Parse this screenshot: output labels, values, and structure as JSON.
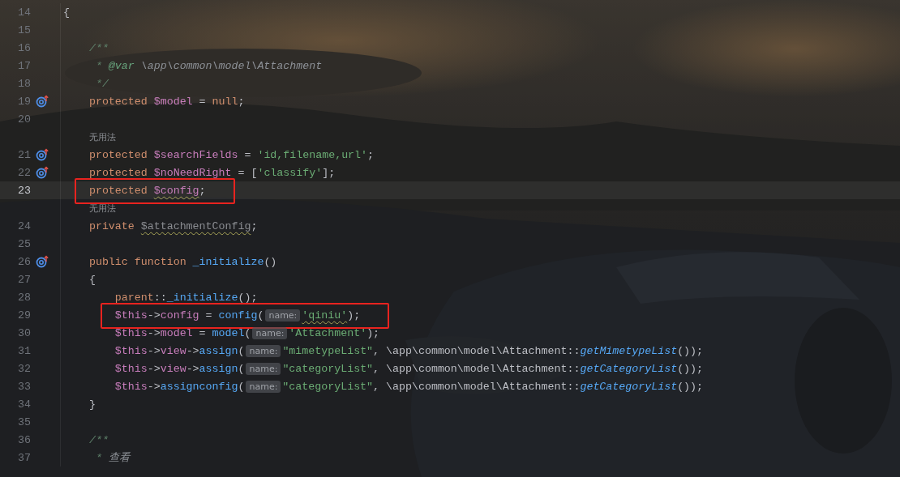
{
  "editor": {
    "lines": [
      {
        "kind": "code",
        "number": "14",
        "overrides": false,
        "current": false,
        "boxed": false,
        "tokens": [
          {
            "t": "{",
            "kind": "plain"
          }
        ]
      },
      {
        "kind": "code",
        "number": "15",
        "overrides": false,
        "current": false,
        "boxed": false
      },
      {
        "kind": "code",
        "number": "16",
        "overrides": false,
        "current": false,
        "boxed": false,
        "tokens": [
          {
            "t": "    /**",
            "kind": "doc"
          }
        ]
      },
      {
        "kind": "code",
        "number": "17",
        "overrides": false,
        "current": false,
        "boxed": false,
        "tokens": [
          {
            "t": "     * ",
            "kind": "doc"
          },
          {
            "t": "@var",
            "kind": "doctag"
          },
          {
            "t": " \\app\\common\\model\\Attachment",
            "kind": "doctext"
          }
        ]
      },
      {
        "kind": "code",
        "number": "18",
        "overrides": false,
        "current": false,
        "boxed": false,
        "tokens": [
          {
            "t": "     */",
            "kind": "doc"
          }
        ]
      },
      {
        "kind": "code",
        "number": "19",
        "overrides": true,
        "current": false,
        "boxed": false,
        "tokens": [
          {
            "t": "    protected ",
            "kind": "kw"
          },
          {
            "t": "$model",
            "kind": "var"
          },
          {
            "t": " = ",
            "kind": "plain"
          },
          {
            "t": "null",
            "kind": "kw"
          },
          {
            "t": ";",
            "kind": "plain"
          }
        ]
      },
      {
        "kind": "code",
        "number": "20",
        "overrides": false,
        "current": false,
        "boxed": false
      },
      {
        "kind": "hint",
        "text": "无用法"
      },
      {
        "kind": "code",
        "number": "21",
        "overrides": true,
        "current": false,
        "boxed": false,
        "tokens": [
          {
            "t": "    protected ",
            "kind": "kw"
          },
          {
            "t": "$searchFields",
            "kind": "var"
          },
          {
            "t": " = ",
            "kind": "plain"
          },
          {
            "t": "'id,filename,url'",
            "kind": "str"
          },
          {
            "t": ";",
            "kind": "plain"
          }
        ]
      },
      {
        "kind": "code",
        "number": "22",
        "overrides": true,
        "current": false,
        "boxed": false,
        "tokens": [
          {
            "t": "    protected ",
            "kind": "kw"
          },
          {
            "t": "$noNeedRight",
            "kind": "var"
          },
          {
            "t": " = [",
            "kind": "plain"
          },
          {
            "t": "'classify'",
            "kind": "str"
          },
          {
            "t": "];",
            "kind": "plain"
          }
        ]
      },
      {
        "kind": "code",
        "number": "23",
        "overrides": false,
        "current": true,
        "boxed": true,
        "tokens": [
          {
            "t": "    protected ",
            "kind": "kw"
          },
          {
            "t": "$config",
            "kind": "var_warn"
          },
          {
            "t": ";",
            "kind": "plain"
          }
        ]
      },
      {
        "kind": "hint",
        "text": "无用法"
      },
      {
        "kind": "code",
        "number": "24",
        "overrides": false,
        "current": false,
        "boxed": false,
        "tokens": [
          {
            "t": "    private ",
            "kind": "kw"
          },
          {
            "t": "$attachmentConfig",
            "kind": "unused"
          },
          {
            "t": ";",
            "kind": "plain"
          }
        ]
      },
      {
        "kind": "code",
        "number": "25",
        "overrides": false,
        "current": false,
        "boxed": false
      },
      {
        "kind": "code",
        "number": "26",
        "overrides": true,
        "current": false,
        "boxed": false,
        "tokens": [
          {
            "t": "    public function ",
            "kind": "kw"
          },
          {
            "t": "_initialize",
            "kind": "fn"
          },
          {
            "t": "()",
            "kind": "plain"
          }
        ]
      },
      {
        "kind": "code",
        "number": "27",
        "overrides": false,
        "current": false,
        "boxed": false,
        "tokens": [
          {
            "t": "    {",
            "kind": "plain"
          }
        ]
      },
      {
        "kind": "code",
        "number": "28",
        "overrides": false,
        "current": false,
        "boxed": false,
        "tokens": [
          {
            "t": "        parent",
            "kind": "kw"
          },
          {
            "t": "::",
            "kind": "plain"
          },
          {
            "t": "_initialize",
            "kind": "fn"
          },
          {
            "t": "();",
            "kind": "plain"
          }
        ]
      },
      {
        "kind": "code",
        "number": "29",
        "overrides": false,
        "current": false,
        "boxed": true,
        "tokens": [
          {
            "t": "        $this",
            "kind": "var"
          },
          {
            "t": "->",
            "kind": "plain"
          },
          {
            "t": "config",
            "kind": "var"
          },
          {
            "t": " = ",
            "kind": "plain"
          },
          {
            "t": "config",
            "kind": "fn"
          },
          {
            "t": "(",
            "kind": "plain"
          },
          {
            "t": "name:",
            "kind": "param"
          },
          {
            "t": "'qiniu'",
            "kind": "str_warn"
          },
          {
            "t": ");",
            "kind": "plain"
          }
        ]
      },
      {
        "kind": "code",
        "number": "30",
        "overrides": false,
        "current": false,
        "boxed": false,
        "tokens": [
          {
            "t": "        $this",
            "kind": "var"
          },
          {
            "t": "->",
            "kind": "plain"
          },
          {
            "t": "model",
            "kind": "var"
          },
          {
            "t": " = ",
            "kind": "plain"
          },
          {
            "t": "model",
            "kind": "fn"
          },
          {
            "t": "(",
            "kind": "plain"
          },
          {
            "t": "name:",
            "kind": "param"
          },
          {
            "t": "'Attachment'",
            "kind": "str"
          },
          {
            "t": ");",
            "kind": "plain"
          }
        ]
      },
      {
        "kind": "code",
        "number": "31",
        "overrides": false,
        "current": false,
        "boxed": false,
        "tokens": [
          {
            "t": "        $this",
            "kind": "var"
          },
          {
            "t": "->",
            "kind": "plain"
          },
          {
            "t": "view",
            "kind": "var"
          },
          {
            "t": "->",
            "kind": "plain"
          },
          {
            "t": "assign",
            "kind": "fn"
          },
          {
            "t": "(",
            "kind": "plain"
          },
          {
            "t": "name:",
            "kind": "param"
          },
          {
            "t": "\"mimetypeList\"",
            "kind": "str"
          },
          {
            "t": ", \\app\\common\\model\\Attachment::",
            "kind": "plain"
          },
          {
            "t": "getMimetypeList",
            "kind": "static"
          },
          {
            "t": "());",
            "kind": "plain"
          }
        ]
      },
      {
        "kind": "code",
        "number": "32",
        "overrides": false,
        "current": false,
        "boxed": false,
        "tokens": [
          {
            "t": "        $this",
            "kind": "var"
          },
          {
            "t": "->",
            "kind": "plain"
          },
          {
            "t": "view",
            "kind": "var"
          },
          {
            "t": "->",
            "kind": "plain"
          },
          {
            "t": "assign",
            "kind": "fn"
          },
          {
            "t": "(",
            "kind": "plain"
          },
          {
            "t": "name:",
            "kind": "param"
          },
          {
            "t": "\"categoryList\"",
            "kind": "str"
          },
          {
            "t": ", \\app\\common\\model\\Attachment::",
            "kind": "plain"
          },
          {
            "t": "getCategoryList",
            "kind": "static"
          },
          {
            "t": "());",
            "kind": "plain"
          }
        ]
      },
      {
        "kind": "code",
        "number": "33",
        "overrides": false,
        "current": false,
        "boxed": false,
        "tokens": [
          {
            "t": "        $this",
            "kind": "var"
          },
          {
            "t": "->",
            "kind": "plain"
          },
          {
            "t": "assignconfig",
            "kind": "fn"
          },
          {
            "t": "(",
            "kind": "plain"
          },
          {
            "t": "name:",
            "kind": "param"
          },
          {
            "t": "\"categoryList\"",
            "kind": "str"
          },
          {
            "t": ", \\app\\common\\model\\Attachment::",
            "kind": "plain"
          },
          {
            "t": "getCategoryList",
            "kind": "static"
          },
          {
            "t": "());",
            "kind": "plain"
          }
        ]
      },
      {
        "kind": "code",
        "number": "34",
        "overrides": false,
        "current": false,
        "boxed": false,
        "tokens": [
          {
            "t": "    }",
            "kind": "plain"
          }
        ]
      },
      {
        "kind": "code",
        "number": "35",
        "overrides": false,
        "current": false,
        "boxed": false
      },
      {
        "kind": "code",
        "number": "36",
        "overrides": false,
        "current": false,
        "boxed": false,
        "tokens": [
          {
            "t": "    /**",
            "kind": "doc"
          }
        ]
      },
      {
        "kind": "code",
        "number": "37",
        "overrides": false,
        "current": false,
        "boxed": false,
        "tokens": [
          {
            "t": "     * ",
            "kind": "doc"
          },
          {
            "t": "查看",
            "kind": "doctext"
          }
        ]
      }
    ]
  }
}
